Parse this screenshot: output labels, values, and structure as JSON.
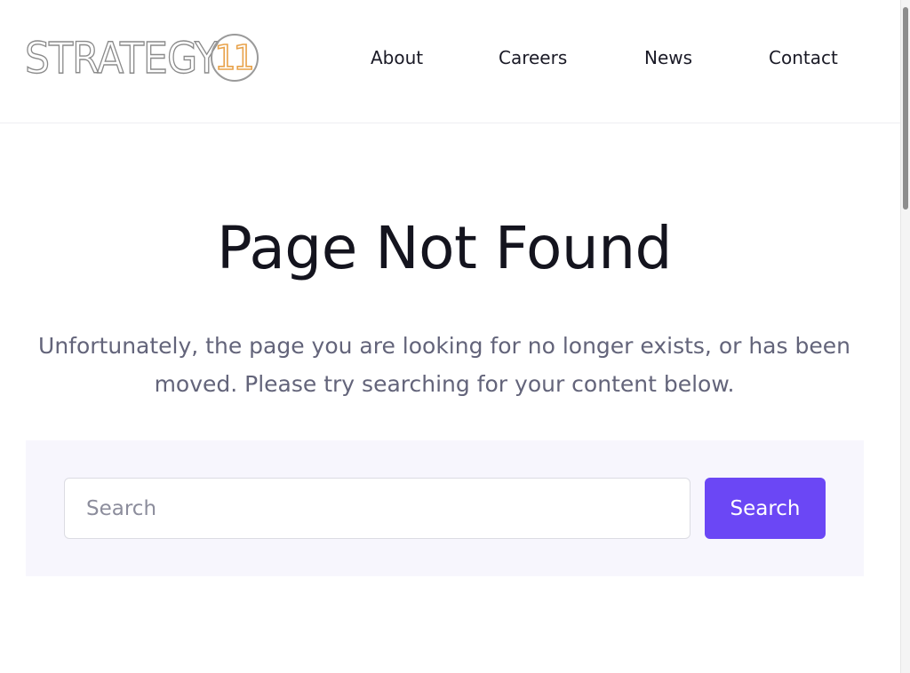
{
  "header": {
    "logo": {
      "word": "STRATEGY",
      "badge": "11"
    },
    "nav": [
      {
        "label": "About"
      },
      {
        "label": "Careers"
      },
      {
        "label": "News"
      },
      {
        "label": "Contact"
      }
    ]
  },
  "main": {
    "title": "Page Not Found",
    "description": "Unfortunately, the page you are looking for no longer exists, or has been moved. Please try searching for your content below.",
    "search": {
      "placeholder": "Search",
      "value": "",
      "button_label": "Search"
    }
  },
  "colors": {
    "accent": "#6b47f5",
    "logo_badge": "#e8a24a",
    "panel_bg": "#f7f6fd"
  }
}
